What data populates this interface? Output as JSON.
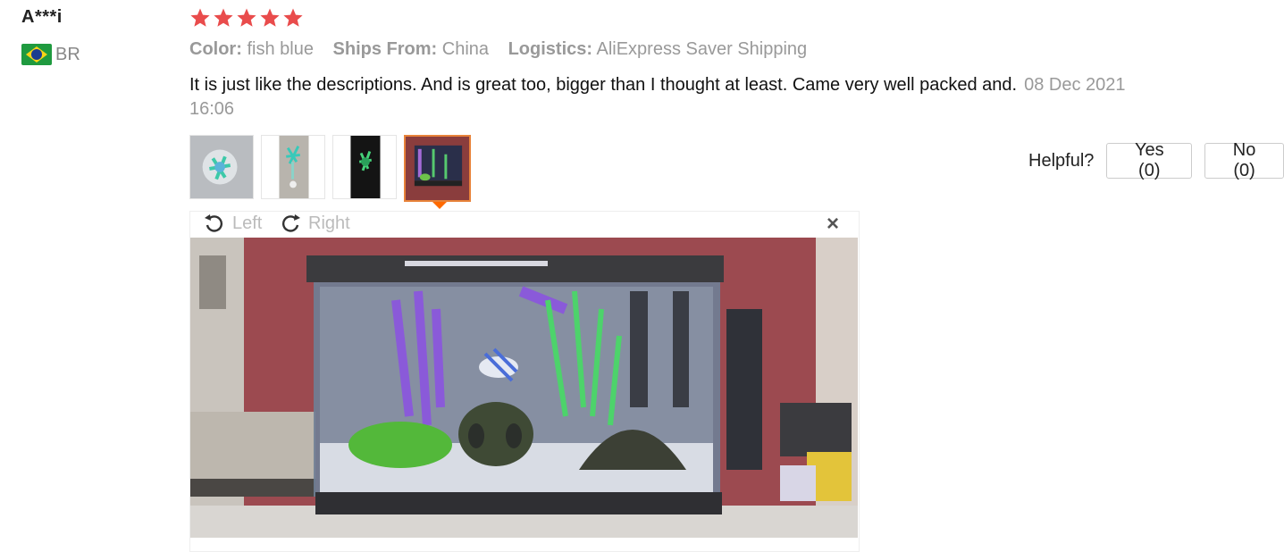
{
  "reviewer": {
    "name": "A***i",
    "country_code": "BR",
    "flag_icon": "brazil-flag-icon"
  },
  "rating": {
    "stars": 5,
    "max": 5,
    "color": "#e94c4c"
  },
  "attributes": [
    {
      "key": "Color:",
      "value": "fish blue"
    },
    {
      "key": "Ships From:",
      "value": "China"
    },
    {
      "key": "Logistics:",
      "value": "AliExpress Saver Shipping"
    }
  ],
  "review": {
    "text": "It is just like the descriptions. And is great too, bigger than I thought at least. Came very well packed and.",
    "date": "08 Dec 2021 16:06"
  },
  "helpful": {
    "label": "Helpful?",
    "yes_label": "Yes (0)",
    "no_label": "No (0)"
  },
  "viewer": {
    "rotate_left_label": "Left",
    "rotate_right_label": "Right",
    "rotate_left_icon": "rotate-left-icon",
    "rotate_right_icon": "rotate-right-icon",
    "close_icon": "close-icon",
    "close_glyph": "×"
  },
  "thumbnails": {
    "count": 4,
    "active_index": 3,
    "active_color": "#e8833a"
  }
}
